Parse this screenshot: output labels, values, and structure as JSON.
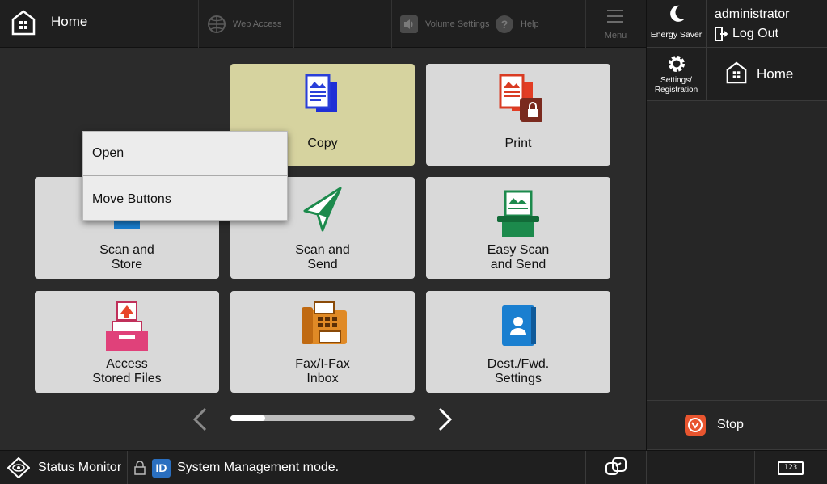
{
  "header": {
    "home_label": "Home",
    "web_access_label": "Web Access",
    "volume_settings_label": "Volume Settings",
    "help_label": "Help",
    "menu_label": "Menu"
  },
  "right_panel": {
    "energy_saver_label": "Energy Saver",
    "username": "administrator",
    "logout_label": "Log Out",
    "settings_label_line1": "Settings/",
    "settings_label_line2": "Registration",
    "home_label": "Home",
    "stop_label": "Stop"
  },
  "tiles": [
    {
      "line1": "Copy",
      "line2": ""
    },
    {
      "line1": "Print",
      "line2": ""
    },
    {
      "line1": "Scan and",
      "line2": "Store"
    },
    {
      "line1": "Scan and",
      "line2": "Send"
    },
    {
      "line1": "Easy Scan",
      "line2": "and Send"
    },
    {
      "line1": "Access",
      "line2": "Stored Files"
    },
    {
      "line1": "Fax/I-Fax",
      "line2": "Inbox"
    },
    {
      "line1": "Dest./Fwd.",
      "line2": "Settings"
    }
  ],
  "context_menu": {
    "items": [
      "Open",
      "Move Buttons"
    ]
  },
  "pager": {
    "progress_fraction": 0.19
  },
  "footer": {
    "status_monitor_label": "Status Monitor",
    "id_badge": "ID",
    "system_message": "System Management mode.",
    "keypad_label": "123"
  },
  "colors": {
    "selected_tile": "#d6d39f",
    "tile": "#d9d9d9",
    "stop_accent": "#e8552f"
  }
}
